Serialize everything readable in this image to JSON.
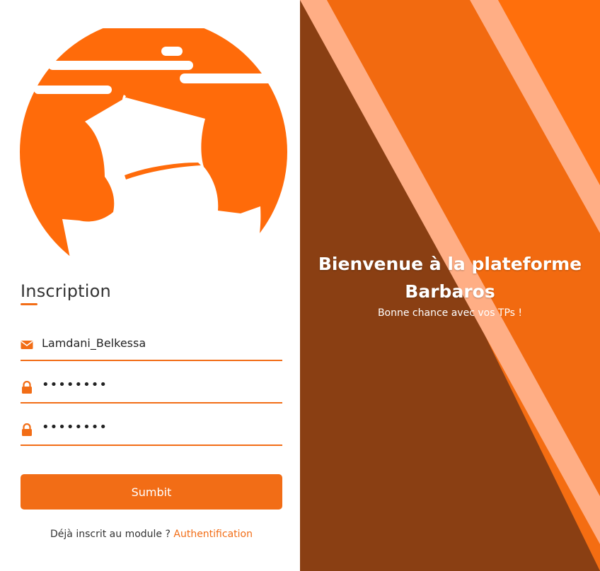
{
  "colors": {
    "accent": "#f26d16",
    "panel_bg": "#8a3f13",
    "stripe": "#ffae85",
    "text_dark": "#333333"
  },
  "form": {
    "title": "Inscription",
    "fields": [
      {
        "icon": "envelope-icon",
        "value": "Lamdani_Belkessa"
      },
      {
        "icon": "lock-icon",
        "value": "••••••••"
      },
      {
        "icon": "lock-icon",
        "value": "••••••••"
      }
    ],
    "submit_label": "Sumbit",
    "footer_text": "Déjà inscrit au module ?",
    "footer_link": "Authentification"
  },
  "welcome": {
    "heading_line1": "Bienvenue à la plateforme",
    "heading_line2": "Barbaros",
    "subtitle": "Bonne chance avec vos TPs !"
  },
  "logo": {
    "icon": "ship-logo-icon"
  }
}
